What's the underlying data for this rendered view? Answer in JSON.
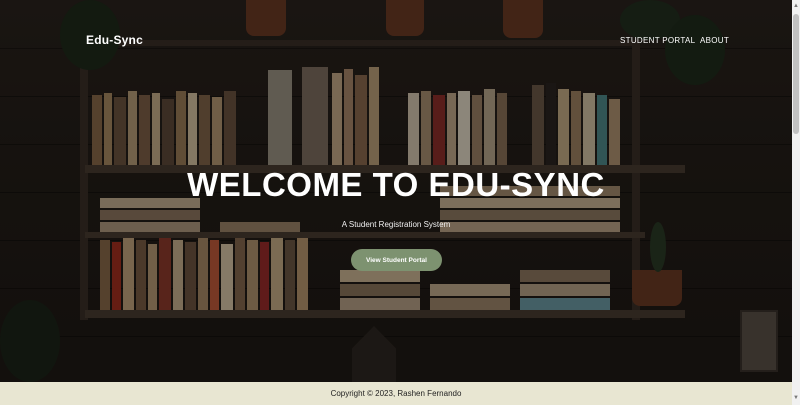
{
  "nav": {
    "brand": "Edu-Sync",
    "links": [
      "STUDENT PORTAL",
      "ABOUT"
    ]
  },
  "hero": {
    "title": "WELCOME TO EDU-SYNC",
    "subtitle": "A Student Registration System",
    "cta_label": "View Student Portal"
  },
  "footer": {
    "copyright": "Copyright © 2023, Rashen Fernando"
  },
  "colors": {
    "cta": "#7d9270",
    "footer_bg": "#e8e6d2"
  }
}
